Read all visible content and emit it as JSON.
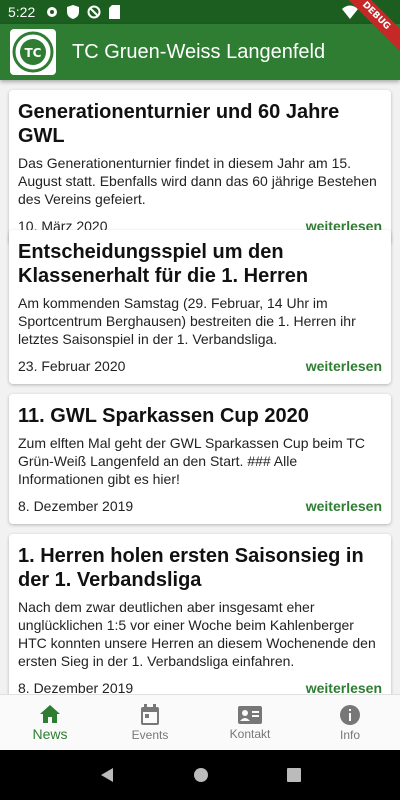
{
  "status_bar": {
    "time": "5:22"
  },
  "debug_label": "DEBUG",
  "app_bar": {
    "title": "TC Gruen-Weiss Langenfeld"
  },
  "colors": {
    "primary": "#2e7d32",
    "primary_dark": "#1b5e20",
    "debug": "#c62828"
  },
  "news": [
    {
      "title": "Generationenturnier und 60 Jahre GWL",
      "text": "Das Generationenturnier findet in diesem Jahr am 15. August statt. Ebenfalls wird dann das 60 jährige Bestehen des Vereins gefeiert.",
      "date": "10. März 2020",
      "more": "weiterlesen"
    },
    {
      "title": "Entscheidungsspiel um den Klassenerhalt für die 1. Herren",
      "text": "Am kommenden Samstag (29. Februar, 14 Uhr im Sportcentrum Berghausen) bestreiten die 1. Herren ihr letztes Saisonspiel in der 1. Verbandsliga.",
      "date": "23. Februar 2020",
      "more": "weiterlesen"
    },
    {
      "title": "11. GWL Sparkassen Cup 2020",
      "text": "Zum elften Mal geht der GWL Sparkassen Cup beim TC Grün-Weiß Langenfeld an den Start. ### Alle Informationen gibt es hier!",
      "date": "8. Dezember 2019",
      "more": "weiterlesen"
    },
    {
      "title": "1. Herren holen ersten Saisonsieg in der 1. Verbandsliga",
      "text": "Nach dem zwar deutlichen aber insgesamt eher unglücklichen 1:5 vor einer Woche beim Kahlenberger HTC konnten unsere Herren an diesem Wochenende den ersten Sieg in der 1. Verbandsliga einfahren.",
      "date": "8. Dezember 2019",
      "more": "weiterlesen"
    }
  ],
  "bottom_nav": [
    {
      "label": "News",
      "icon": "home-icon",
      "active": true
    },
    {
      "label": "Events",
      "icon": "calendar-icon",
      "active": false
    },
    {
      "label": "Kontakt",
      "icon": "contact-card-icon",
      "active": false
    },
    {
      "label": "Info",
      "icon": "info-icon",
      "active": false
    }
  ]
}
